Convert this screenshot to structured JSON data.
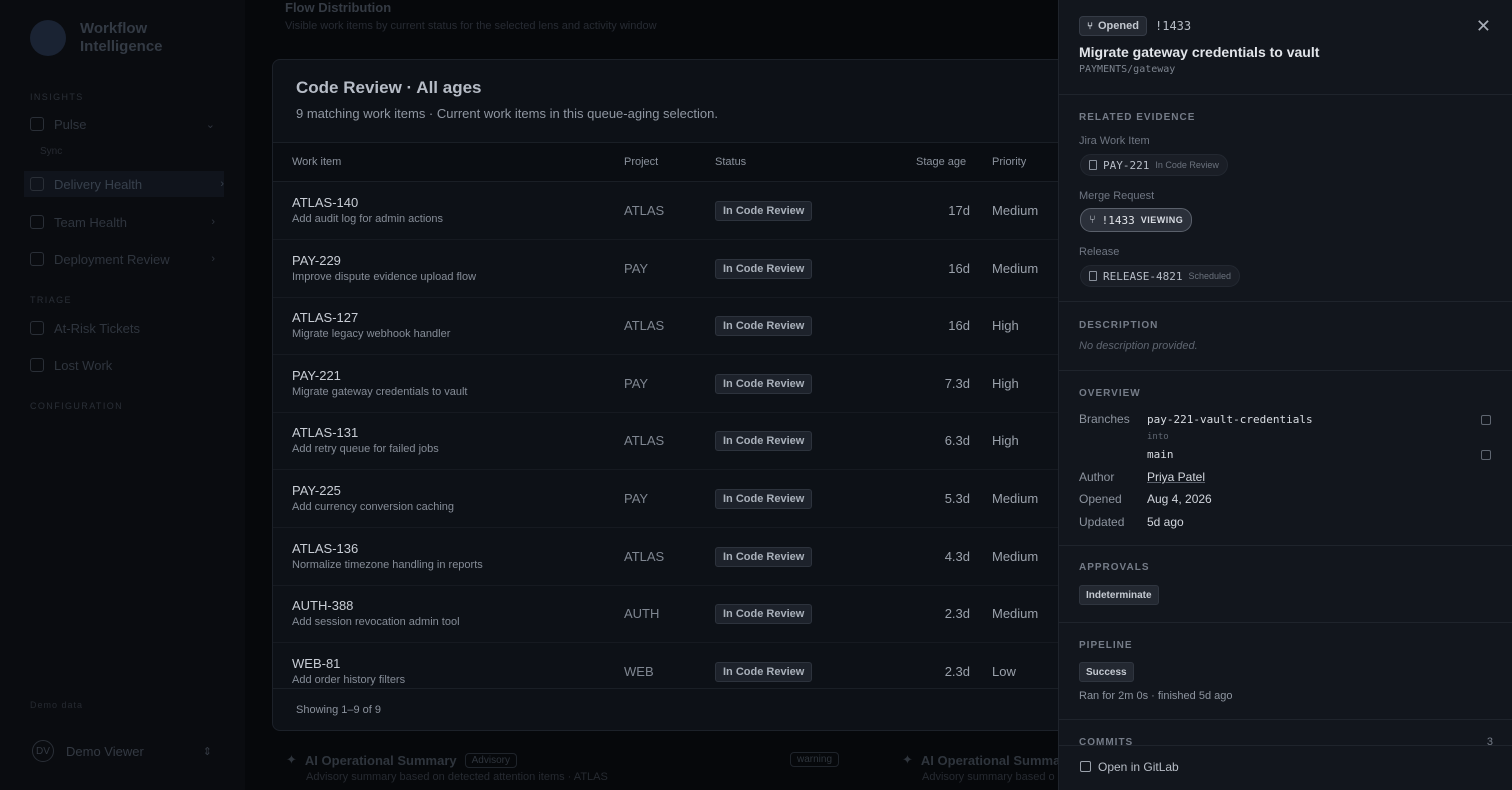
{
  "sidebar": {
    "brand": "Workflow Intelligence",
    "section1": "Insights",
    "items": [
      {
        "label": "Pulse"
      },
      {
        "label": "Delivery Health"
      },
      {
        "label": "Team Health"
      },
      {
        "label": "Deployment Review"
      }
    ],
    "sub_item": "Sync",
    "section2": "Triage",
    "triage_items": [
      {
        "label": "At-Risk Tickets"
      },
      {
        "label": "Lost Work"
      }
    ],
    "section3": "Configuration",
    "demo_data": "Demo data",
    "user": {
      "initials": "DV",
      "name": "Demo Viewer"
    }
  },
  "background": {
    "flow_title": "Flow Distribution",
    "flow_subtitle": "Visible work items by current status for the selected lens and activity window",
    "ai_title": "AI Operational Summary",
    "ai_badge": "Advisory",
    "ai_warning": "warning",
    "ai_title_2": "AI Operational Summa",
    "ai_subtitle": "Advisory summary based on detected attention items · ATLAS",
    "ai_subtitle_2": "Advisory summary based o"
  },
  "modal": {
    "title": "Code Review · All ages",
    "subtitle": "9 matching work items · Current work items in this queue-aging selection.",
    "columns": [
      "Work item",
      "Project",
      "Status",
      "Stage age",
      "Priority"
    ],
    "rows": [
      {
        "id": "ATLAS-140",
        "desc": "Add audit log for admin actions",
        "project": "ATLAS",
        "status": "In Code Review",
        "age": "17d",
        "priority": "Medium"
      },
      {
        "id": "PAY-229",
        "desc": "Improve dispute evidence upload flow",
        "project": "PAY",
        "status": "In Code Review",
        "age": "16d",
        "priority": "Medium"
      },
      {
        "id": "ATLAS-127",
        "desc": "Migrate legacy webhook handler",
        "project": "ATLAS",
        "status": "In Code Review",
        "age": "16d",
        "priority": "High"
      },
      {
        "id": "PAY-221",
        "desc": "Migrate gateway credentials to vault",
        "project": "PAY",
        "status": "In Code Review",
        "age": "7.3d",
        "priority": "High"
      },
      {
        "id": "ATLAS-131",
        "desc": "Add retry queue for failed jobs",
        "project": "ATLAS",
        "status": "In Code Review",
        "age": "6.3d",
        "priority": "High"
      },
      {
        "id": "PAY-225",
        "desc": "Add currency conversion caching",
        "project": "PAY",
        "status": "In Code Review",
        "age": "5.3d",
        "priority": "Medium"
      },
      {
        "id": "ATLAS-136",
        "desc": "Normalize timezone handling in reports",
        "project": "ATLAS",
        "status": "In Code Review",
        "age": "4.3d",
        "priority": "Medium"
      },
      {
        "id": "AUTH-388",
        "desc": "Add session revocation admin tool",
        "project": "AUTH",
        "status": "In Code Review",
        "age": "2.3d",
        "priority": "Medium"
      },
      {
        "id": "WEB-81",
        "desc": "Add order history filters",
        "project": "WEB",
        "status": "In Code Review",
        "age": "2.3d",
        "priority": "Low"
      }
    ],
    "footer": "Showing 1–9 of 9"
  },
  "panel": {
    "state": "Opened",
    "mr_id": "!1433",
    "title": "Migrate gateway credentials to vault",
    "path": "PAYMENTS/gateway",
    "related_label": "RELATED EVIDENCE",
    "jira_label": "Jira Work Item",
    "jira_id": "PAY-221",
    "jira_status": "In Code Review",
    "mr_label": "Merge Request",
    "mr_chip": "!1433",
    "mr_tag": "VIEWING",
    "release_label": "Release",
    "release_id": "RELEASE-4821",
    "release_status": "Scheduled",
    "description_label": "DESCRIPTION",
    "description": "No description provided.",
    "overview_label": "OVERVIEW",
    "branches_label": "Branches",
    "source_branch": "pay-221-vault-credentials",
    "into": "into",
    "target_branch": "main",
    "author_label": "Author",
    "author": "Priya Patel",
    "opened_label": "Opened",
    "opened": "Aug 4, 2026",
    "updated_label": "Updated",
    "updated": "5d ago",
    "approvals_label": "APPROVALS",
    "approvals": "Indeterminate",
    "pipeline_label": "PIPELINE",
    "pipeline_status": "Success",
    "pipeline_detail": "Ran for 2m 0s · finished 5d ago",
    "commits_label": "COMMITS",
    "commits_count": "3",
    "open_gitlab": "Open in GitLab"
  }
}
